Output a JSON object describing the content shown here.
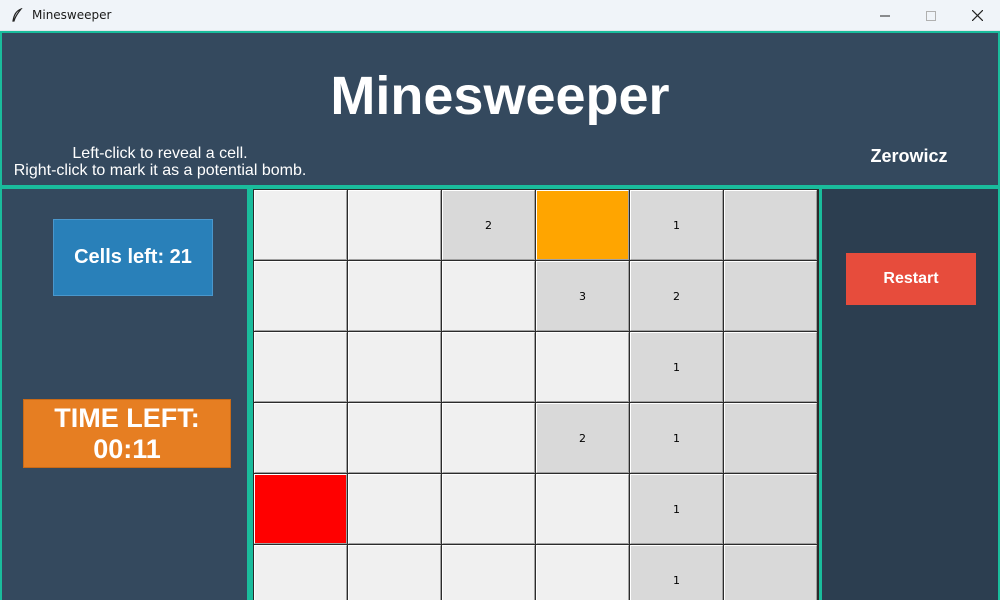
{
  "window": {
    "title": "Minesweeper",
    "icon": "feather-icon",
    "controls": [
      "minimize-icon",
      "maximize-icon",
      "close-icon"
    ]
  },
  "header": {
    "title": "Minesweeper",
    "instructions": {
      "line1": "Left-click to reveal a cell.",
      "line2": "Right-click to mark it as a potential bomb."
    },
    "player": "Zerowicz"
  },
  "status": {
    "cells_left": "Cells left: 21",
    "timer_label": "TIME LEFT:",
    "timer_value": "00:11"
  },
  "controls": {
    "restart_label": "Restart"
  },
  "board": {
    "columns": 6,
    "visible_rows": 6,
    "rows": [
      [
        {
          "state": "hidden",
          "label": ""
        },
        {
          "state": "hidden",
          "label": ""
        },
        {
          "state": "revealed",
          "label": "2"
        },
        {
          "state": "flagged",
          "label": ""
        },
        {
          "state": "revealed",
          "label": "1"
        },
        {
          "state": "revealed",
          "label": ""
        }
      ],
      [
        {
          "state": "hidden",
          "label": ""
        },
        {
          "state": "hidden",
          "label": ""
        },
        {
          "state": "hidden",
          "label": ""
        },
        {
          "state": "revealed",
          "label": "3"
        },
        {
          "state": "revealed",
          "label": "2"
        },
        {
          "state": "revealed",
          "label": ""
        }
      ],
      [
        {
          "state": "hidden",
          "label": ""
        },
        {
          "state": "hidden",
          "label": ""
        },
        {
          "state": "hidden",
          "label": ""
        },
        {
          "state": "hidden",
          "label": ""
        },
        {
          "state": "revealed",
          "label": "1"
        },
        {
          "state": "revealed",
          "label": ""
        }
      ],
      [
        {
          "state": "hidden",
          "label": ""
        },
        {
          "state": "hidden",
          "label": ""
        },
        {
          "state": "hidden",
          "label": ""
        },
        {
          "state": "revealed",
          "label": "2"
        },
        {
          "state": "revealed",
          "label": "1"
        },
        {
          "state": "revealed",
          "label": ""
        }
      ],
      [
        {
          "state": "bomb",
          "label": ""
        },
        {
          "state": "hidden",
          "label": ""
        },
        {
          "state": "hidden",
          "label": ""
        },
        {
          "state": "hidden",
          "label": ""
        },
        {
          "state": "revealed",
          "label": "1"
        },
        {
          "state": "revealed",
          "label": ""
        }
      ],
      [
        {
          "state": "hidden",
          "label": ""
        },
        {
          "state": "hidden",
          "label": ""
        },
        {
          "state": "hidden",
          "label": ""
        },
        {
          "state": "hidden",
          "label": ""
        },
        {
          "state": "revealed",
          "label": "1"
        },
        {
          "state": "revealed",
          "label": ""
        }
      ]
    ]
  },
  "colors": {
    "panel": "#34495e",
    "accent_border": "#1abc9c",
    "cells_left_bg": "#2980b9",
    "timer_bg": "#e67e22",
    "restart_bg": "#e74c3c",
    "flagged_cell": "#ffa500",
    "bomb_cell": "#ff0000",
    "hidden_cell": "#f0f0f0",
    "revealed_cell": "#d9d9d9"
  }
}
